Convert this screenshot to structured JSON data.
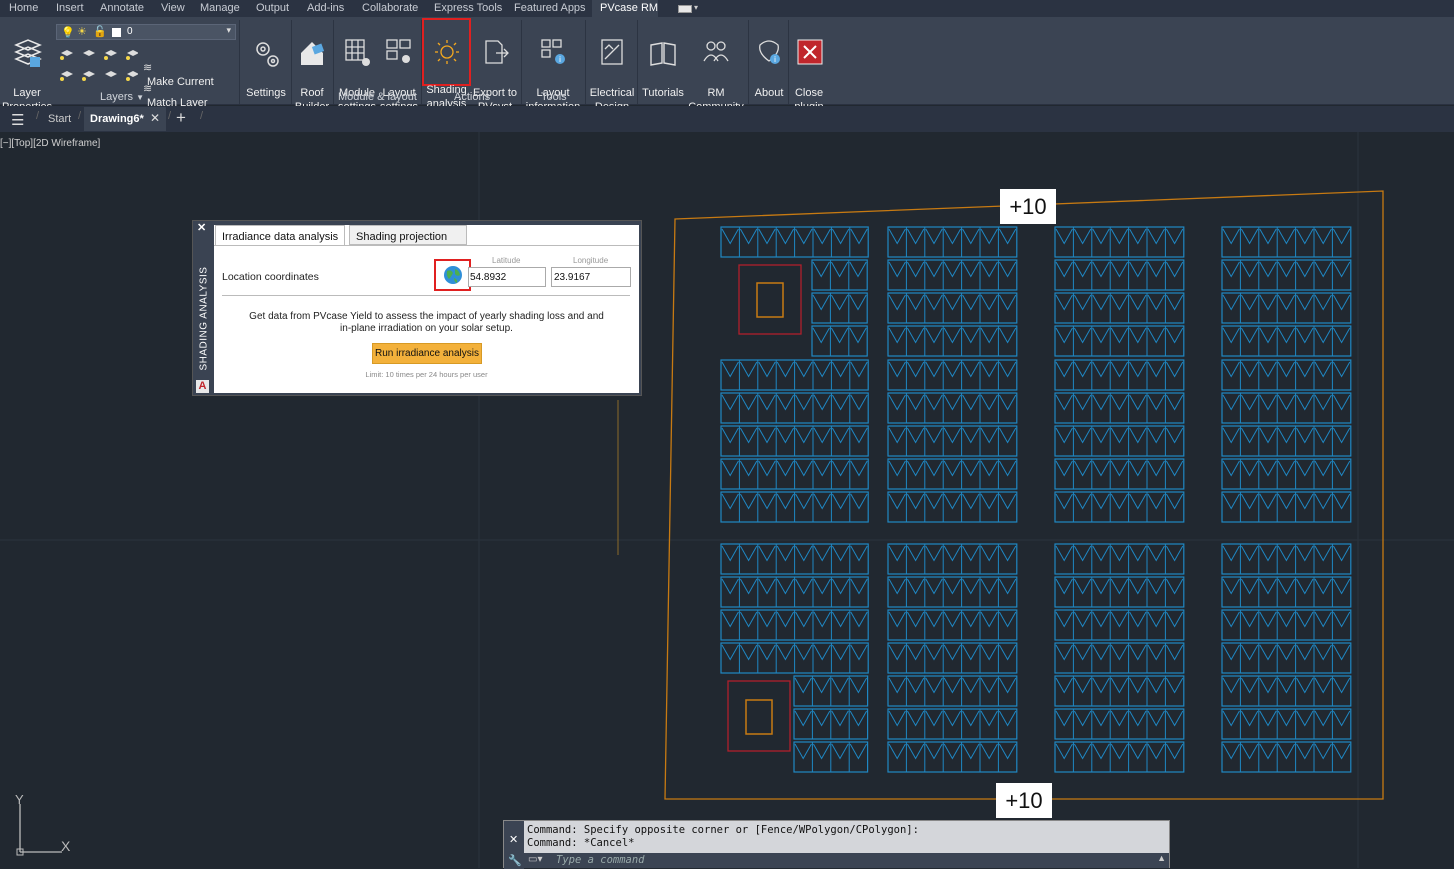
{
  "menu": {
    "items": [
      "Home",
      "Insert",
      "Annotate",
      "View",
      "Manage",
      "Output",
      "Add-ins",
      "Collaborate",
      "Express Tools",
      "Featured Apps",
      "PVcase RM"
    ],
    "active": "PVcase RM"
  },
  "ribbon": {
    "layer_properties": "Layer\nProperties",
    "layer_dropdown_value": "0",
    "make_current": "Make Current",
    "match_layer": "Match Layer",
    "layers_panel": "Layers",
    "settings": "Settings",
    "roof_builder": "Roof\nBuilder",
    "module_settings": "Module\nsettings",
    "layout_settings": "Layout\nsettings",
    "module_layout_panel": "Module & layout",
    "shading_analysis": "Shading\nanalysis",
    "export_pvsyst": "Export to\nPVsyst",
    "actions_panel": "Actions",
    "layout_information": "Layout\ninformation",
    "tools_panel": "Tools",
    "electrical_design": "Electrical\nDesign",
    "tutorials": "Tutorials",
    "rm_community": "RM\nCommunity",
    "about": "About",
    "close_plugin": "Close\nplugin"
  },
  "filetabs": {
    "start": "Start",
    "drawing": "Drawing6*"
  },
  "viewport": {
    "label": "[−][Top][2D Wireframe]",
    "elevation_top": "+10",
    "elevation_bottom": "+10"
  },
  "dialog": {
    "side_title": "SHADING ANALYSIS",
    "tab_irradiance": "Irradiance data analysis",
    "tab_shading": "Shading projection",
    "location_label": "Location coordinates",
    "latitude_label": "Latitude",
    "longitude_label": "Longitude",
    "latitude_value": "54.8932",
    "longitude_value": "23.9167",
    "description_line1": "Get data from PVcase Yield to assess the impact of yearly shading loss and and",
    "description_line2": "in-plane irradiation on your solar setup.",
    "run_button": "Run irradiance analysis",
    "limit_text": "Limit: 10 times per 24 hours per user"
  },
  "command": {
    "line1": "Command: Specify opposite corner or [Fence/WPolygon/CPolygon]:",
    "line2": "Command: *Cancel*",
    "placeholder": "Type a command"
  },
  "ucs": {
    "y": "Y",
    "x": "X"
  },
  "colors": {
    "accent_red": "#e02020",
    "panel_blue": "#1f88c4",
    "boundary_orange": "#c77a12",
    "obstacle_red": "#b0202c",
    "run_button": "#f3b13b"
  }
}
